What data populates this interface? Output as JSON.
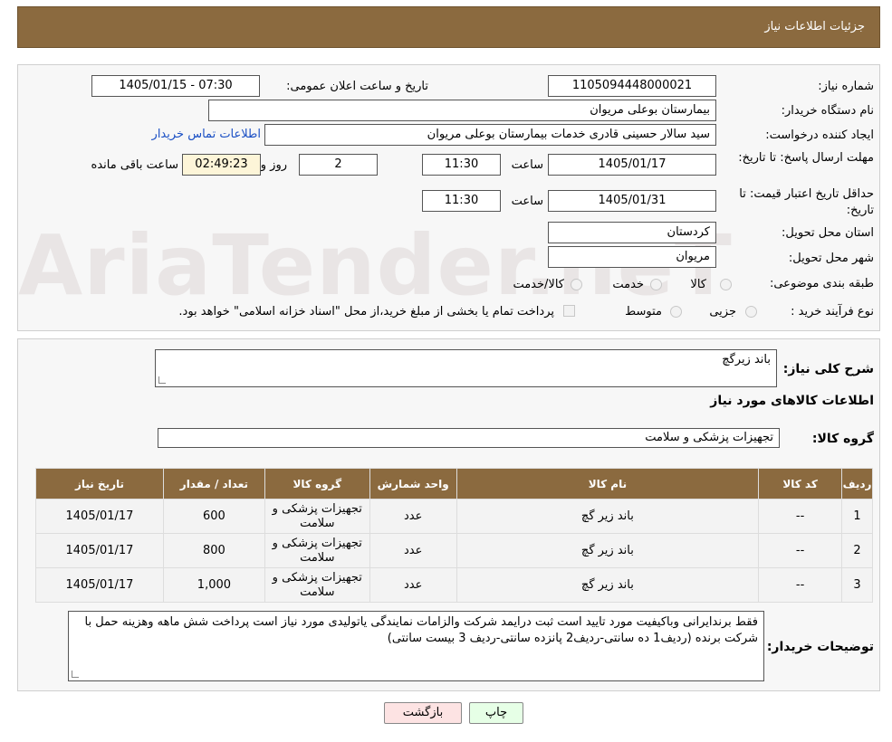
{
  "header": {
    "title": "جزئیات اطلاعات نیاز"
  },
  "watermark": "AriaTender.neT",
  "fields": {
    "need_number_label": "شماره نیاز:",
    "need_number": "1105094448000021",
    "announce_label": "تاریخ و ساعت اعلان عمومی:",
    "announce_value": "1405/01/15 - 07:30",
    "buyer_org_label": "نام دستگاه خریدار:",
    "buyer_org": "بیمارستان بوعلی مریوان",
    "requester_label": "ایجاد کننده درخواست:",
    "requester": "سید سالار حسینی قادری خدمات بیمارستان بوعلی مریوان",
    "contact_link": "اطلاعات تماس خریدار",
    "send_deadline_label": "مهلت ارسال پاسخ: تا تاریخ:",
    "send_date": "1405/01/17",
    "time_label": "ساعت",
    "send_time": "11:30",
    "days_value": "2",
    "days_label": "روز و",
    "remaining_time": "02:49:23",
    "remaining_label": "ساعت باقی مانده",
    "validity_label": "حداقل تاریخ اعتبار قیمت: تا تاریخ:",
    "validity_date": "1405/01/31",
    "validity_time": "11:30",
    "province_label": "استان محل تحویل:",
    "province": "کردستان",
    "city_label": "شهر محل تحویل:",
    "city": "مریوان",
    "category_label": "طبقه بندی موضوعی:",
    "category_options": [
      "کالا",
      "خدمت",
      "کالا/خدمت"
    ],
    "process_label": "نوع فرآیند خرید :",
    "process_options": [
      "جزیی",
      "متوسط"
    ],
    "payment_note": "پرداخت تمام یا بخشی از مبلغ خرید،از محل \"اسناد خزانه اسلامی\" خواهد بود."
  },
  "summary": {
    "label": "شرح کلی نیاز:",
    "value": "باند زیرگچ",
    "goods_info_title": "اطلاعات کالاهای مورد نیاز",
    "group_label": "گروه کالا:",
    "group_value": "تجهیزات پزشکی و سلامت"
  },
  "table": {
    "headers": [
      "ردیف",
      "کد کالا",
      "نام کالا",
      "واحد شمارش",
      "گروه کالا",
      "تعداد / مقدار",
      "تاریخ نیاز"
    ],
    "rows": [
      [
        "1",
        "--",
        "باند زیر گچ",
        "عدد",
        "تجهیزات پزشکی و سلامت",
        "600",
        "1405/01/17"
      ],
      [
        "2",
        "--",
        "باند زیر گچ",
        "عدد",
        "تجهیزات پزشکی و سلامت",
        "800",
        "1405/01/17"
      ],
      [
        "3",
        "--",
        "باند زیر گچ",
        "عدد",
        "تجهیزات پزشکی و سلامت",
        "1,000",
        "1405/01/17"
      ]
    ]
  },
  "buyer_notes": {
    "label": "توضیحات خریدار:",
    "value": "فقط برندایرانی وباکیفیت مورد تایید است  ثبت درایمد شرکت والزامات نمایندگی یاتولیدی مورد نیاز است پرداخت شش ماهه وهزینه حمل با شرکت برنده (ردیف1 ده سانتی-ردیف2 پانزده سانتی-ردیف 3 بیست سانتی)"
  },
  "buttons": {
    "print": "چاپ",
    "back": "بازگشت"
  },
  "colors": {
    "header_bg": "#8b6a3f",
    "back_button_bg": "#fde3e3",
    "print_button_bg": "#e6ffe6",
    "link": "#1a4fc4"
  }
}
